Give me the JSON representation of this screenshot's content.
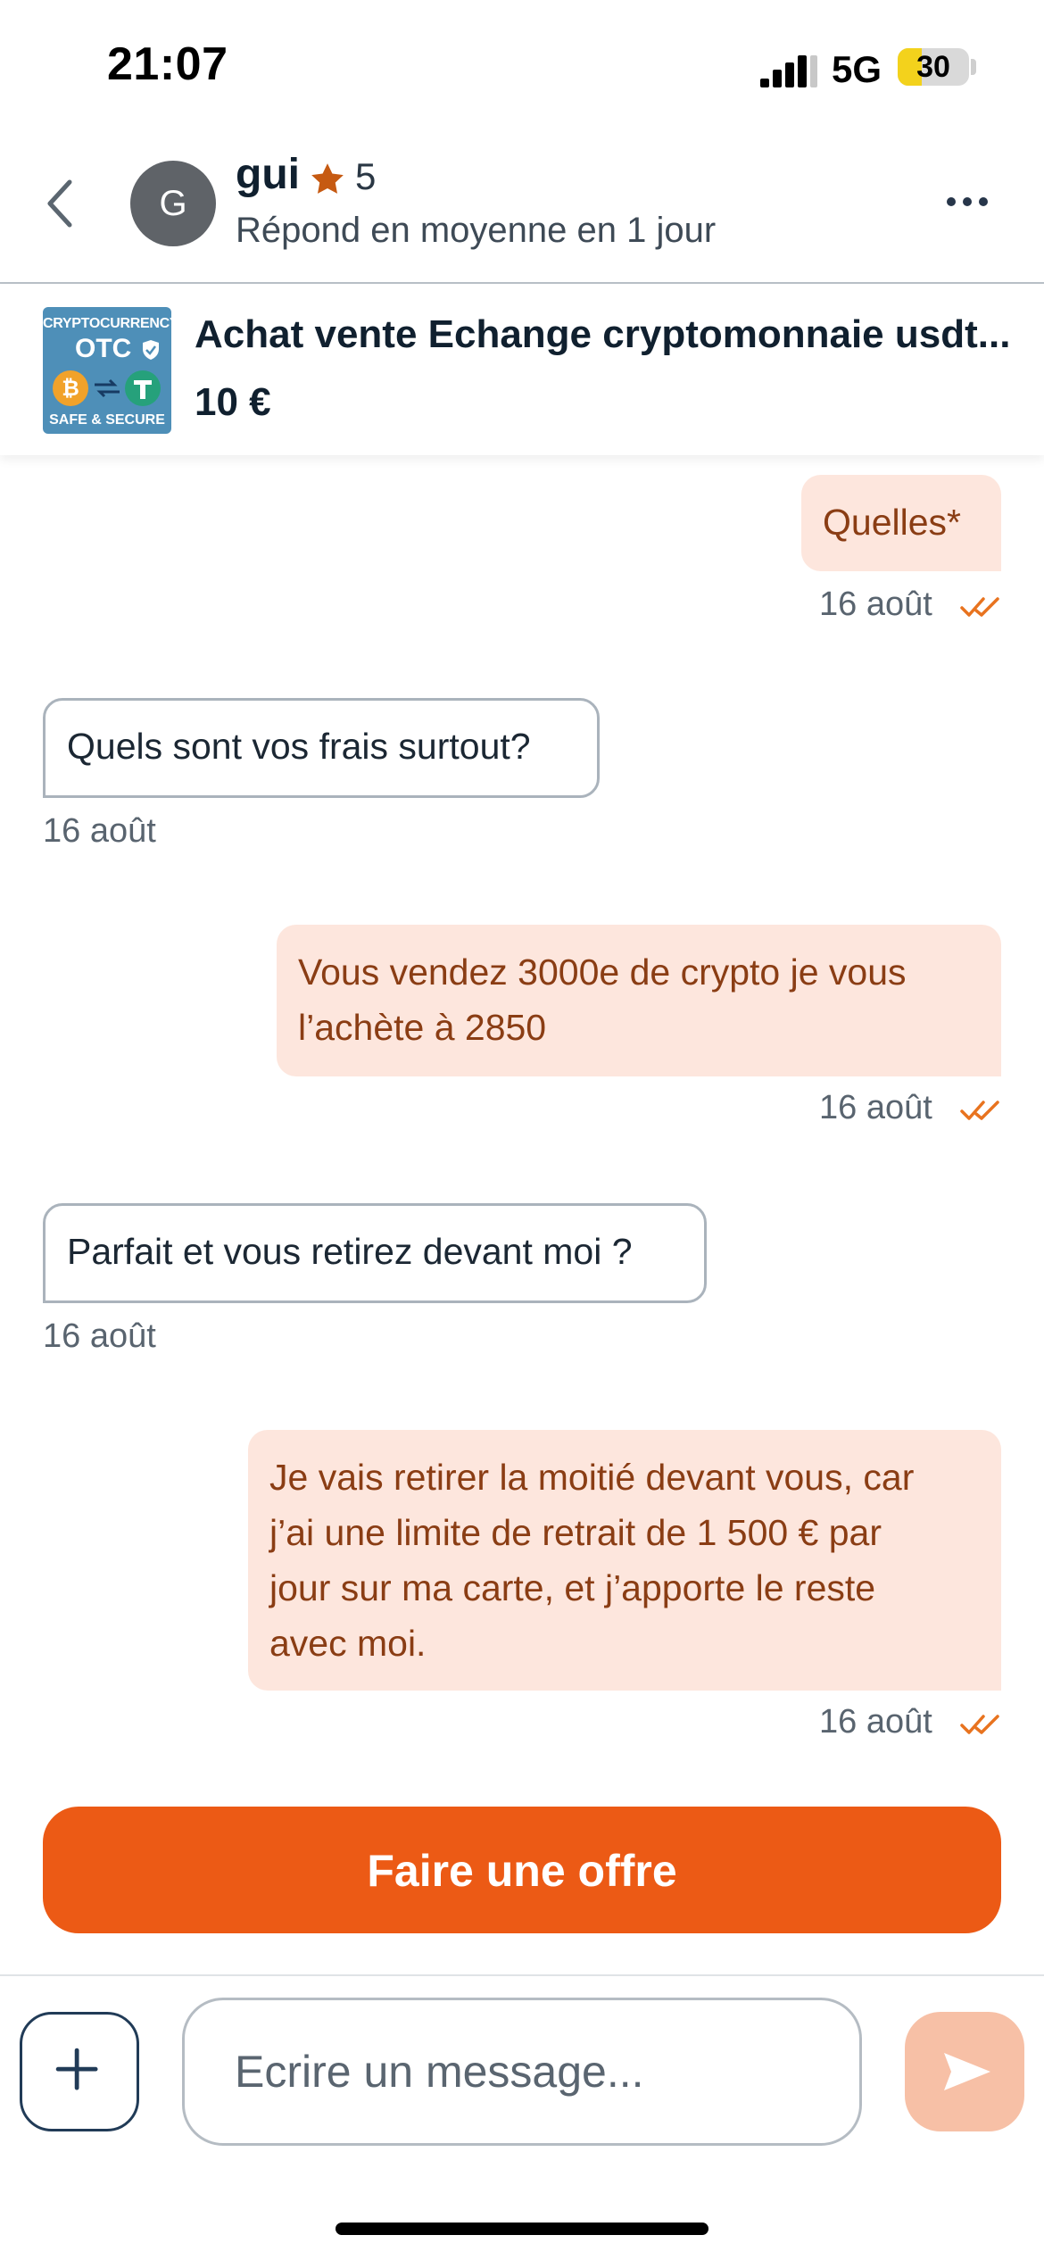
{
  "status_bar": {
    "time": "21:07",
    "network": "5G",
    "battery": "30",
    "battery_level": 0.3
  },
  "header": {
    "back_icon": "chevron-left-icon",
    "avatar_initial": "G",
    "name": "gui",
    "rating": "5",
    "subtitle": "Répond en moyenne en 1 jour",
    "more_icon": "more-horizontal-icon"
  },
  "listing": {
    "thumb": {
      "line1": "CRYPTOCURRENCY",
      "line2": "OTC",
      "line3": "SAFE & SECURE"
    },
    "title": "Achat vente Echange cryptomonnaie usdt...",
    "price": "10 €"
  },
  "messages": [
    {
      "direction": "out",
      "lines": [
        "Quelles*"
      ],
      "time": "16 août"
    },
    {
      "direction": "in",
      "lines": [
        "Quels sont vos frais surtout?"
      ],
      "time": "16 août"
    },
    {
      "direction": "out",
      "lines": [
        "Vous vendez 3000e de crypto je vous",
        "l’achète à 2850"
      ],
      "time": "16 août"
    },
    {
      "direction": "in",
      "lines": [
        "Parfait et vous retirez devant moi ?"
      ],
      "time": "16 août"
    },
    {
      "direction": "out",
      "lines": [
        "Je vais retirer la moitié devant vous, car",
        "j’ai une limite de retrait de 1 500 € par",
        "jour sur ma carte, et j’apporte le reste",
        "avec moi."
      ],
      "time": "16 août"
    }
  ],
  "offer_button": "Faire une offre",
  "composer": {
    "placeholder": "Ecrire un message...",
    "add_icon": "plus-icon",
    "send_icon": "send-icon"
  },
  "colors": {
    "accent": "#ec5a15",
    "bubble_out": "#fde6dd",
    "bubble_out_text": "#8a3d14"
  }
}
